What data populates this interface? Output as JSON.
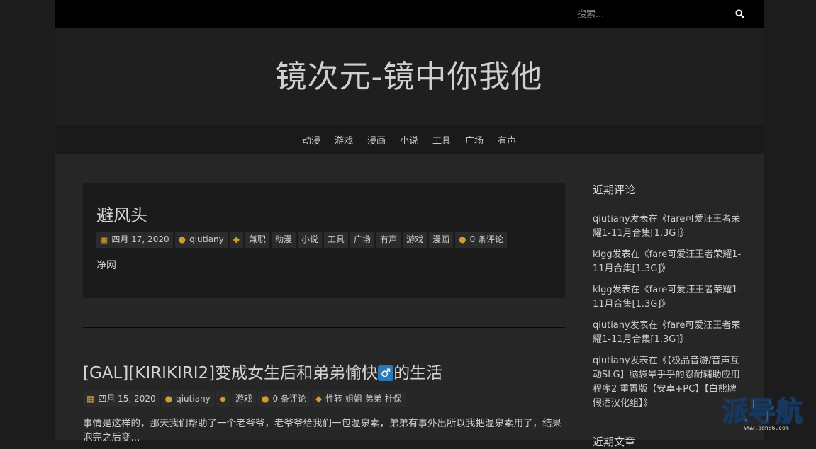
{
  "search": {
    "placeholder": "搜索..."
  },
  "site": {
    "title": "镜次元-镜中你我他"
  },
  "nav": {
    "items": [
      "动漫",
      "游戏",
      "漫画",
      "小说",
      "工具",
      "广场",
      "有声"
    ]
  },
  "post1": {
    "title": "避风头",
    "date": "四月 17, 2020",
    "author": "qiutiany",
    "tags": [
      "兼职",
      "动漫",
      "小说",
      "工具",
      "广场",
      "有声",
      "游戏",
      "漫画"
    ],
    "comments": "0 条评论",
    "excerpt": "净网"
  },
  "post2": {
    "title_prefix": "[GAL][KIRIKIRI2]变成女生后和弟弟愉快",
    "title_emoji": "♂",
    "title_suffix": "的生活",
    "date": "四月 15, 2020",
    "author": "qiutiany",
    "category": "游戏",
    "comments": "0 条评论",
    "tags": "性转 姐姐 弟弟 社保",
    "excerpt": "事情是这样的，那天我们帮助了一个老爷爷，老爷爷给我们一包温泉素，弟弟有事外出所以我把温泉素用了，结果泡完之后变..."
  },
  "sidebar": {
    "recent_comments_title": "近期评论",
    "recent_comments": [
      "qiutiany发表在《fare可爱汪王者荣耀1-11月合集[1.3G]》",
      "klgg发表在《fare可爱汪王者荣耀1-11月合集[1.3G]》",
      "klgg发表在《fare可爱汪王者荣耀1-11月合集[1.3G]》",
      "qiutiany发表在《fare可爱汪王者荣耀1-11月合集[1.3G]》",
      "qiutiany发表在《【极品音游/音声互动SLG】脑袋晕乎乎的忍耐辅助应用程序2 重置版【安卓+PC】【白熊牌假酒汉化组】》"
    ],
    "recent_posts_title": "近期文章"
  },
  "watermark": {
    "text": "派导航",
    "url": "www.pdh86.com"
  },
  "icons": {
    "search": "search-icon",
    "calendar": "calendar-icon",
    "user": "user-icon",
    "tag": "tag-icon",
    "comment": "comment-icon"
  },
  "colors": {
    "accent": "#d69a2d",
    "topbar": "#000000",
    "background": "#1c1c1c"
  }
}
